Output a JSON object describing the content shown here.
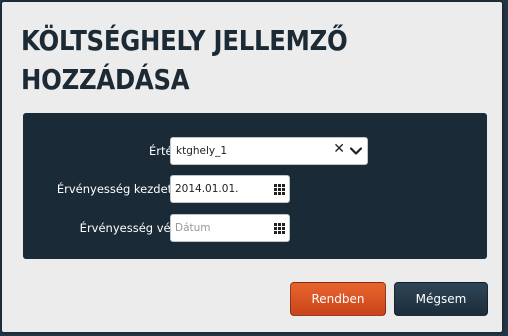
{
  "dialog": {
    "title": "KÖLTSÉGHELY JELLEMZŐ HOZZÁDÁSA"
  },
  "form": {
    "value_field": {
      "label": "Érték*",
      "selected": "ktghely_1",
      "clear_icon": "close-icon",
      "dropdown_icon": "chevron-down-icon"
    },
    "valid_from": {
      "label": "Érvényesség kezdete*",
      "value": "2014.01.01.",
      "placeholder": "",
      "icon": "calendar-icon"
    },
    "valid_to": {
      "label": "Érvényesség vége",
      "value": "",
      "placeholder": "Dátum",
      "icon": "calendar-icon"
    }
  },
  "buttons": {
    "ok_label": "Rendben",
    "cancel_label": "Mégsem"
  },
  "colors": {
    "backdrop": "#243746",
    "dialog_bg": "#ececec",
    "panel_bg": "#1b2a37",
    "primary_button": "#d9531f",
    "secondary_button": "#253a4a"
  }
}
